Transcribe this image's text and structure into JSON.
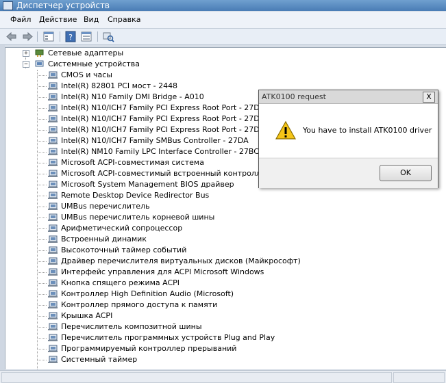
{
  "window": {
    "title": "Диспетчер устройств"
  },
  "menu": [
    "Файл",
    "Действие",
    "Вид",
    "Справка"
  ],
  "toolbar": {
    "buttons": [
      "back-icon",
      "forward-icon",
      "properties-icon",
      "help-icon",
      "view-icon",
      "scan-hardware-icon"
    ]
  },
  "tree": {
    "categories": [
      {
        "label": "Сетевые адаптеры",
        "expander": "+"
      },
      {
        "label": "Системные устройства",
        "expander": "−"
      }
    ],
    "devices": [
      "CMOS и часы",
      "Intel(R) 82801 PCI мост - 2448",
      "Intel(R) N10 Family DMI Bridge - A010",
      "Intel(R) N10/ICH7 Family PCI Express Root Port - 27D0",
      "Intel(R) N10/ICH7 Family PCI Express Root Port - 27D2",
      "Intel(R) N10/ICH7 Family PCI Express Root Port - 27D6",
      "Intel(R) N10/ICH7 Family SMBus Controller - 27DA",
      "Intel(R) NM10 Family LPC Interface Controller - 27BC",
      "Microsoft ACPI-совместимая система",
      "Microsoft ACPI-совместимый встроенный контроллер",
      "Microsoft System Management BIOS драйвер",
      "Remote Desktop Device Redirector Bus",
      "UMBus перечислитель",
      "UMBus перечислитель корневой шины",
      "Арифметический сопроцессор",
      "Встроенный динамик",
      "Высокоточный таймер событий",
      "Драйвер перечислителя виртуальных дисков (Майкрософт)",
      "Интерфейс управления для ACPI Microsoft Windows",
      "Кнопка спящего режима ACPI",
      "Контроллер High Definition Audio (Microsoft)",
      "Контроллер прямого доступа к памяти",
      "Крышка ACPI",
      "Перечислитель композитной шины",
      "Перечислитель программных устройств Plug and Play",
      "Программируемый контроллер прерываний",
      "Системный таймер"
    ]
  },
  "dialog": {
    "title": "ATK0100 request",
    "message": "You have to install ATK0100 driver",
    "ok_label": "OK",
    "close_label": "X",
    "icon": "warning-icon"
  }
}
